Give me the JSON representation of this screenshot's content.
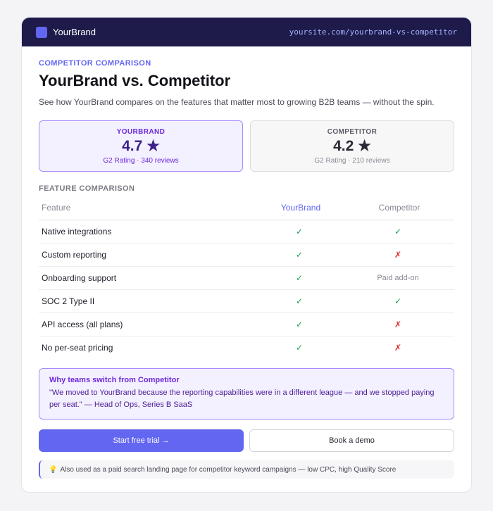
{
  "header": {
    "brand": "YourBrand",
    "url": "yoursite.com/yourbrand-vs-competitor"
  },
  "hero": {
    "eyebrow": "COMPETITOR COMPARISON",
    "title": "YourBrand vs. Competitor",
    "subtitle": "See how YourBrand compares on the features that matter most to growing B2B teams — without the spin."
  },
  "ratings": {
    "ours": {
      "label": "YOURBRAND",
      "score": "4.7 ★",
      "sub": "G2 Rating · 340 reviews"
    },
    "theirs": {
      "label": "COMPETITOR",
      "score": "4.2 ★",
      "sub": "G2 Rating · 210 reviews"
    }
  },
  "comparison": {
    "section_label": "FEATURE COMPARISON",
    "headers": {
      "feature": "Feature",
      "ours": "YourBrand",
      "theirs": "Competitor"
    },
    "rows": [
      {
        "feature": "Native integrations",
        "ours": "✓",
        "theirs": "✓"
      },
      {
        "feature": "Custom reporting",
        "ours": "✓",
        "theirs": "✗"
      },
      {
        "feature": "Onboarding support",
        "ours": "✓",
        "theirs": "Paid add-on"
      },
      {
        "feature": "SOC 2 Type II",
        "ours": "✓",
        "theirs": "✓"
      },
      {
        "feature": "API access (all plans)",
        "ours": "✓",
        "theirs": "✗"
      },
      {
        "feature": "No per-seat pricing",
        "ours": "✓",
        "theirs": "✗"
      }
    ]
  },
  "quote": {
    "title": "Why teams switch from Competitor",
    "text": "\"We moved to YourBrand because the reporting capabilities were in a different league — and we stopped paying per seat.\" — Head of Ops, Series B SaaS"
  },
  "cta": {
    "primary": "Start free trial →",
    "secondary": "Book a demo"
  },
  "note": {
    "icon": "💡",
    "text": "Also used as a paid search landing page for competitor keyword campaigns — low CPC, high Quality Score"
  },
  "colors": {
    "accent": "#6366f1",
    "header_bg": "#1e1b4b",
    "check": "#16a34a",
    "cross": "#dc2626"
  }
}
